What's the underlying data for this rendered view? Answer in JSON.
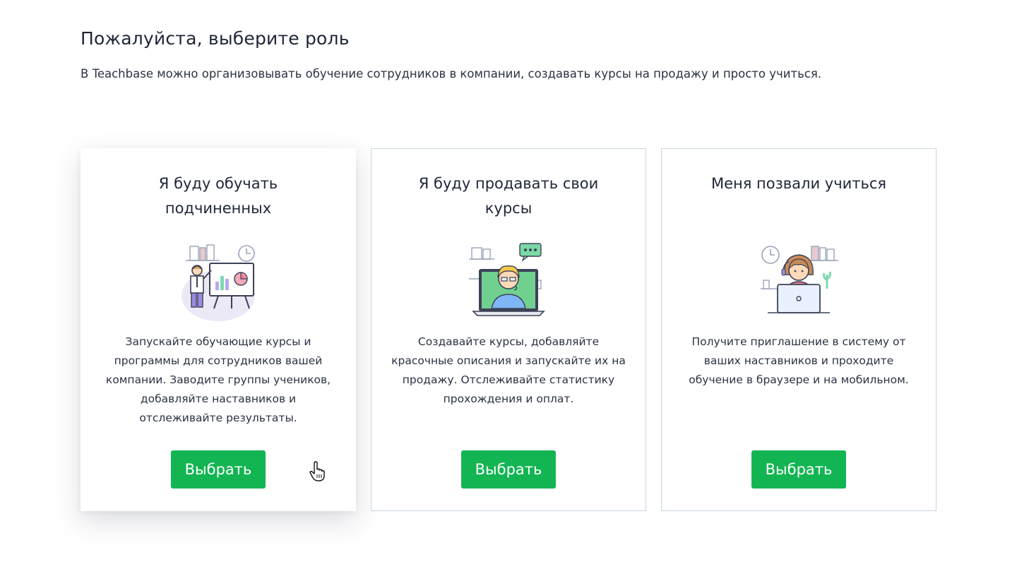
{
  "header": {
    "title": "Пожалуйста, выберите роль",
    "subtitle": "В Teachbase можно организовывать обучение сотрудников в компании, создавать курсы на продажу и  просто учиться."
  },
  "cards": [
    {
      "title": "Я буду обучать подчиненных",
      "description": "Запускайте обучающие курсы и программы для сотрудников вашей компании. Заводите группы учеников, добавляйте наставников и отслеживайте результаты.",
      "button_label": "Выбрать",
      "illustration": "presentation-icon",
      "active": true
    },
    {
      "title": "Я буду продавать свои курсы",
      "description": "Создавайте курсы, добавляйте красочные описания и запускайте их на продажу. Отслеживайте статистику прохождения и оплат.",
      "button_label": "Выбрать",
      "illustration": "video-call-icon",
      "active": false
    },
    {
      "title": "Меня позвали учиться",
      "description": "Получите приглашение в систему от ваших наставников  и проходите обучение в браузере и на мобильном.",
      "button_label": "Выбрать",
      "illustration": "student-laptop-icon",
      "active": false
    }
  ],
  "colors": {
    "accent": "#12b552",
    "card_border": "#c7d3e0",
    "text": "#1e2637"
  }
}
